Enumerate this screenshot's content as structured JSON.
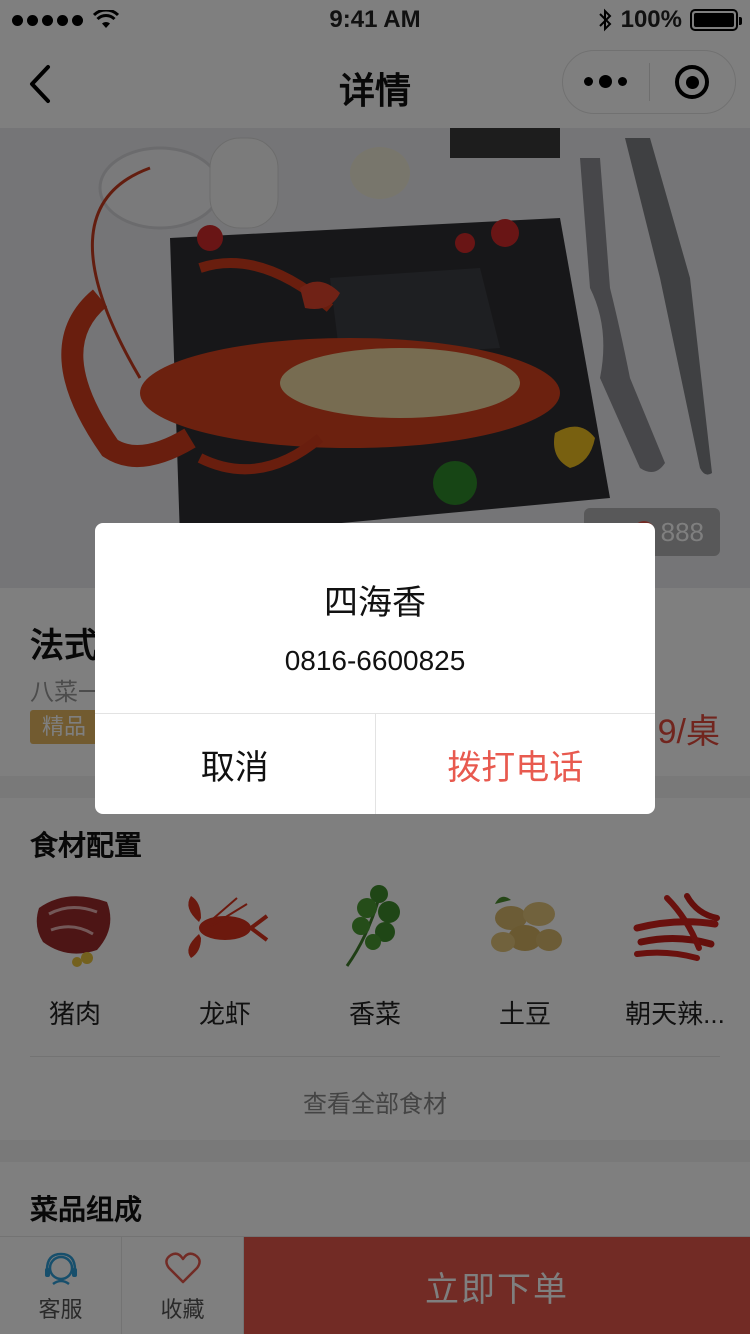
{
  "status_bar": {
    "time": "9:41 AM",
    "battery": "100%"
  },
  "nav": {
    "title": "详情"
  },
  "hero": {
    "views": "888"
  },
  "dish": {
    "name": "法式",
    "desc": "八菜一",
    "tag": "精品",
    "price": "9/桌"
  },
  "ingredients": {
    "title": "食材配置",
    "items": [
      {
        "name": "猪肉",
        "icon": "pork-icon"
      },
      {
        "name": "龙虾",
        "icon": "lobster-icon"
      },
      {
        "name": "香菜",
        "icon": "coriander-icon"
      },
      {
        "name": "土豆",
        "icon": "potato-icon"
      },
      {
        "name": "朝天辣...",
        "icon": "chili-icon"
      }
    ],
    "see_all": "查看全部食材"
  },
  "composition": {
    "title": "菜品组成"
  },
  "bottom_bar": {
    "service": "客服",
    "favorite": "收藏",
    "order": "立即下单"
  },
  "dialog": {
    "title": "四海香",
    "phone": "0816-6600825",
    "cancel": "取消",
    "call": "拨打电话"
  },
  "colors": {
    "accent": "#e5574a",
    "tag": "#e4b760",
    "call_text": "#e85a4f"
  }
}
